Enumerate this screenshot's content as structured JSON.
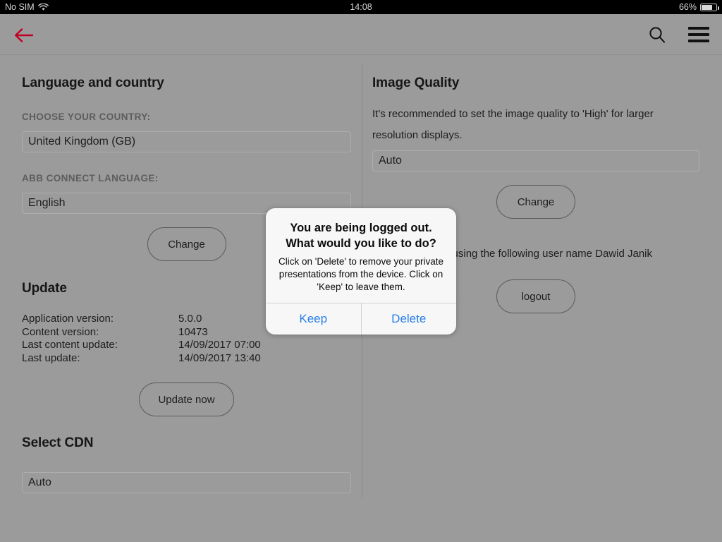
{
  "status_bar": {
    "carrier": "No SIM",
    "wifi_icon": "wifi-icon",
    "time": "14:08",
    "battery_percent": "66%",
    "battery_level": 66
  },
  "nav_bar": {
    "back_icon": "back-arrow-icon",
    "back_color": "#c00020",
    "search_icon": "search-icon",
    "menu_icon": "hamburger-menu-icon"
  },
  "left_column": {
    "language_section": {
      "title": "Language and country",
      "country_label": "CHOOSE YOUR COUNTRY:",
      "country_value": "United Kingdom (GB)",
      "language_label": "ABB CONNECT LANGUAGE:",
      "language_value": "English",
      "change_button": "Change"
    },
    "update_section": {
      "title": "Update",
      "rows": [
        {
          "key": "Application version:",
          "value": "5.0.0"
        },
        {
          "key": "Content version:",
          "value": "10473"
        },
        {
          "key": "Last content update:",
          "value": "14/09/2017 07:00"
        },
        {
          "key": "Last update:",
          "value": "14/09/2017 13:40"
        }
      ],
      "update_button": "Update now"
    },
    "cdn_section": {
      "title": "Select CDN",
      "cdn_value": "Auto"
    }
  },
  "right_column": {
    "image_quality_section": {
      "title": "Image Quality",
      "description": "It's recommended to set the image quality to 'High' for larger resolution displays.",
      "quality_value": "Auto",
      "change_button": "Change"
    },
    "account_section": {
      "description": "using the following user name Dawid Janik",
      "logout_button": "logout"
    }
  },
  "modal": {
    "title_line1": "You are being logged out.",
    "title_line2": "What would you like to do?",
    "message": "Click on 'Delete' to remove your private presentations from the device. Click on 'Keep' to leave them.",
    "keep_label": "Keep",
    "delete_label": "Delete",
    "action_color": "#2a7fe8"
  }
}
